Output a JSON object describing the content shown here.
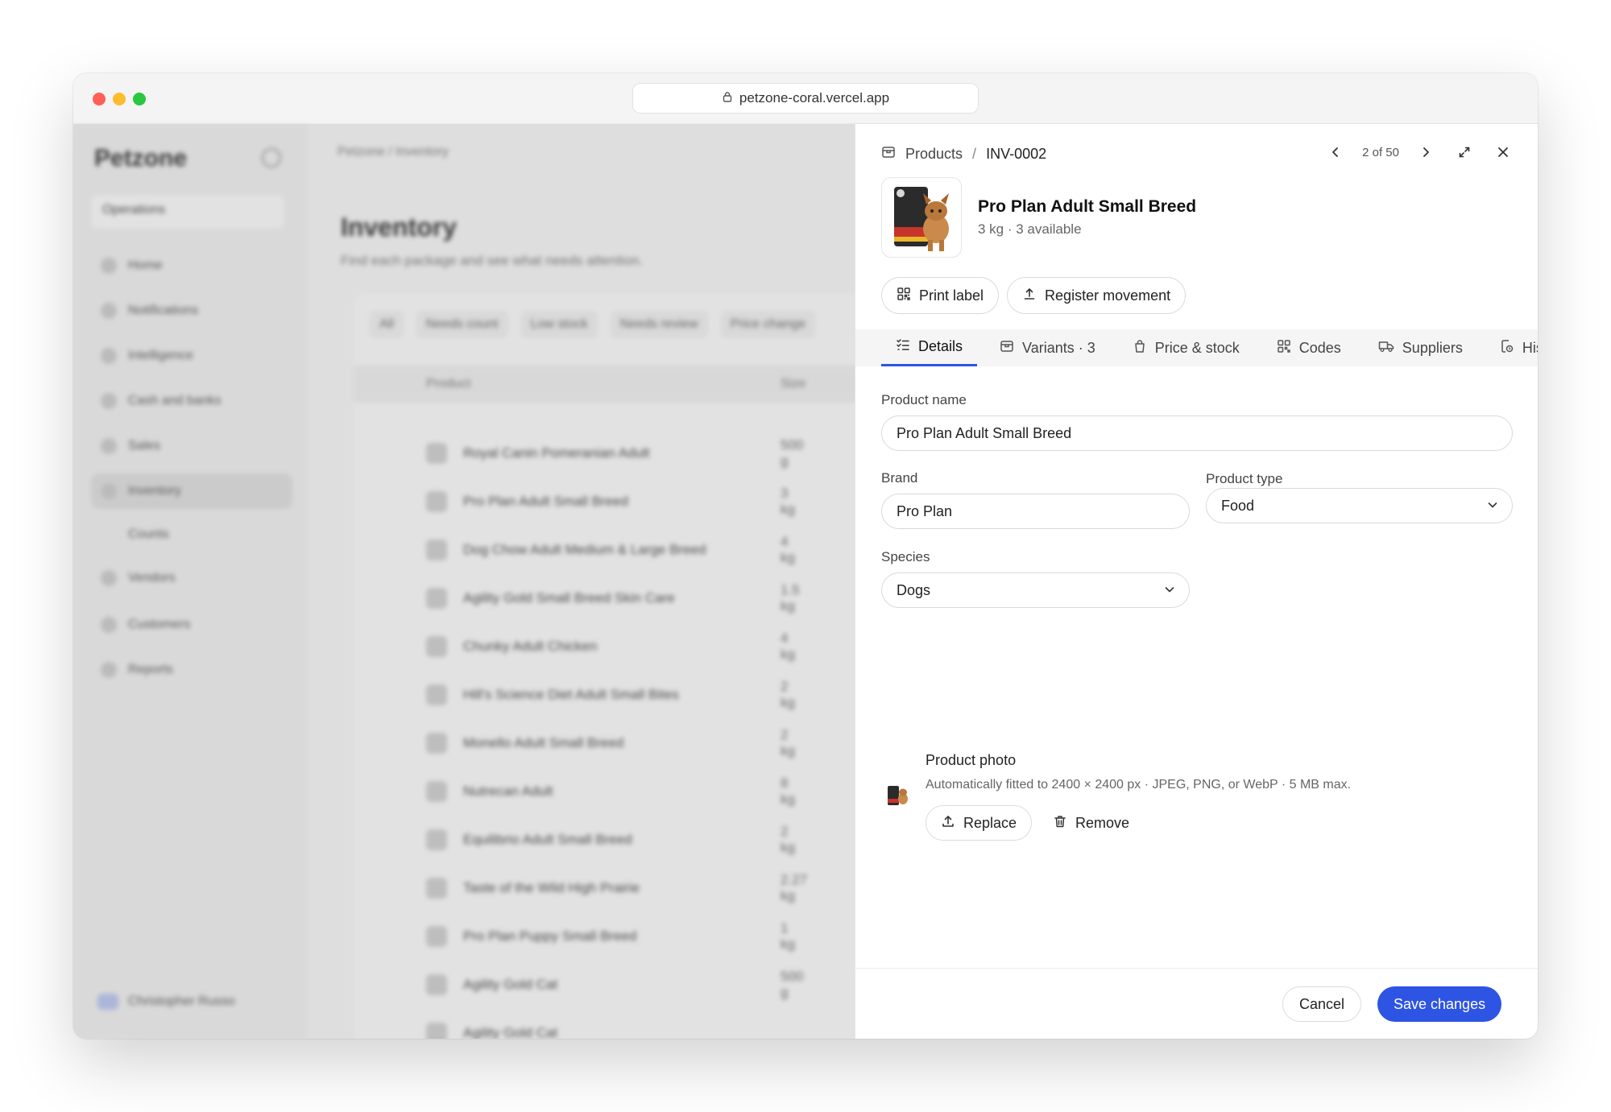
{
  "browser": {
    "url": "petzone-coral.vercel.app"
  },
  "background": {
    "logo": "Petzone",
    "workspace": "Operations",
    "nav": [
      "Home",
      "Notifications",
      "Intelligence",
      "Cash and banks",
      "Sales",
      "Inventory",
      "Counts",
      "Vendors",
      "Customers",
      "Reports"
    ],
    "user": "Christopher Russo",
    "breadcrumb": "Petzone / Inventory",
    "title": "Inventory",
    "subtitle": "Find each package and see what needs attention.",
    "chips": [
      "All",
      "Needs count",
      "Low stock",
      "Needs review",
      "Price change"
    ],
    "table_header": {
      "product": "Product",
      "size": "Size"
    },
    "rows": [
      {
        "name": "Royal Canin Pomeranian Adult",
        "size": "500 g"
      },
      {
        "name": "Pro Plan Adult Small Breed",
        "size": "3 kg"
      },
      {
        "name": "Dog Chow Adult Medium & Large Breed",
        "size": "4 kg"
      },
      {
        "name": "Agility Gold Small Breed Skin Care",
        "size": "1.5 kg"
      },
      {
        "name": "Chunky Adult Chicken",
        "size": "4 kg"
      },
      {
        "name": "Hill's Science Diet Adult Small Bites",
        "size": "2 kg"
      },
      {
        "name": "Monello Adult Small Breed",
        "size": "2 kg"
      },
      {
        "name": "Nutrecan Adult",
        "size": "8 kg"
      },
      {
        "name": "Equilibrio Adult Small Breed",
        "size": "2 kg"
      },
      {
        "name": "Taste of the Wild High Prairie",
        "size": "2.27 kg"
      },
      {
        "name": "Pro Plan Puppy Small Breed",
        "size": "1 kg"
      },
      {
        "name": "Agility Gold Cat",
        "size": "500 g"
      },
      {
        "name": "Agility Gold Cat",
        "size": ""
      }
    ]
  },
  "drawer": {
    "breadcrumb": {
      "root": "Products",
      "separator": "/",
      "current": "INV-0002"
    },
    "pager": "2 of 50",
    "product": {
      "title": "Pro Plan Adult Small Breed",
      "subtitle": "3 kg · 3 available"
    },
    "actions": {
      "print_label": "Print label",
      "register_movement": "Register movement"
    },
    "tabs": [
      "Details",
      "Variants · 3",
      "Price & stock",
      "Codes",
      "Suppliers",
      "History"
    ],
    "form": {
      "product_name_label": "Product name",
      "product_name_value": "Pro Plan Adult Small Breed",
      "brand_label": "Brand",
      "brand_value": "Pro Plan",
      "type_label": "Product type",
      "type_value": "Food",
      "species_label": "Species",
      "species_value": "Dogs"
    },
    "photo": {
      "title": "Product photo",
      "description": "Automatically fitted to 2400 × 2400 px · JPEG, PNG, or WebP · 5 MB max.",
      "replace": "Replace",
      "remove": "Remove"
    },
    "footer": {
      "cancel": "Cancel",
      "save": "Save changes"
    }
  },
  "colors": {
    "accent": "#2d54e3"
  }
}
